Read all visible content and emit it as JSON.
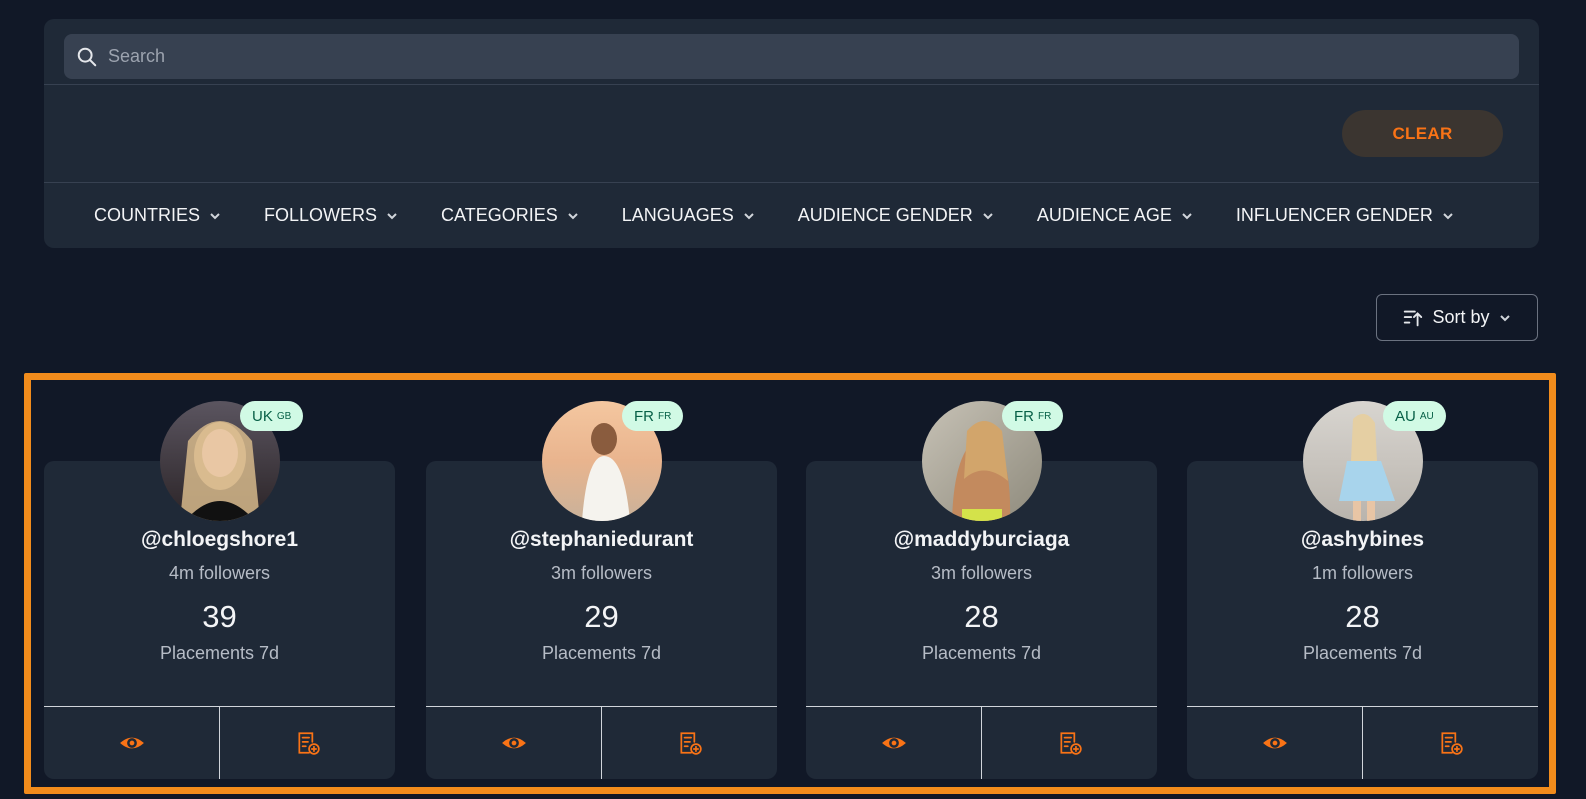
{
  "search": {
    "placeholder": "Search"
  },
  "clear_label": "CLEAR",
  "filters": [
    {
      "label": "COUNTRIES"
    },
    {
      "label": "FOLLOWERS"
    },
    {
      "label": "CATEGORIES"
    },
    {
      "label": "LANGUAGES"
    },
    {
      "label": "AUDIENCE GENDER"
    },
    {
      "label": "AUDIENCE AGE"
    },
    {
      "label": "INFLUENCER GENDER"
    }
  ],
  "sort": {
    "label": "Sort by"
  },
  "influencers": [
    {
      "handle": "@chloegshore1",
      "followers": "4m followers",
      "placements": "39",
      "placements_label": "Placements 7d",
      "country": "UK",
      "country_code": "GB"
    },
    {
      "handle": "@stephaniedurant",
      "followers": "3m followers",
      "placements": "29",
      "placements_label": "Placements 7d",
      "country": "FR",
      "country_code": "FR"
    },
    {
      "handle": "@maddyburciaga",
      "followers": "3m followers",
      "placements": "28",
      "placements_label": "Placements 7d",
      "country": "FR",
      "country_code": "FR"
    },
    {
      "handle": "@ashybines",
      "followers": "1m followers",
      "placements": "28",
      "placements_label": "Placements 7d",
      "country": "AU",
      "country_code": "AU"
    }
  ],
  "icons": {
    "search": "search-icon",
    "chevron": "chevron-down-icon",
    "sort": "sort-icon",
    "view": "eye-icon",
    "add_to_list": "add-to-list-icon"
  },
  "colors": {
    "accent": "#f97316",
    "highlight": "#f28c1c",
    "badge_bg": "#d1fae5"
  }
}
